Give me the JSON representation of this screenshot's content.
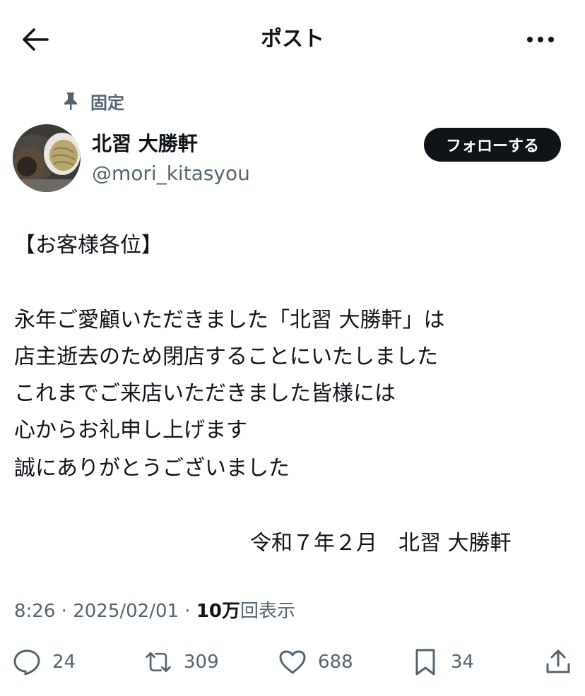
{
  "header": {
    "title": "ポスト",
    "back_icon": "arrow-left-icon",
    "more_icon": "more-horizontal-icon"
  },
  "pinned": {
    "label": "固定",
    "icon": "pin-icon"
  },
  "author": {
    "display_name": "北習 大勝軒",
    "handle": "@mori_kitasyou"
  },
  "follow_label": "フォローする",
  "post": {
    "lines": [
      "【お客様各位】",
      "永年ご愛顧いただきました「北習 大勝軒」は",
      "店主逝去のため閉店することにいたしました",
      "これまでご来店いただきました皆様には",
      "心からお礼申し上げます",
      "誠にありがとうございました"
    ],
    "signature": "令和７年２月　北習 大勝軒"
  },
  "meta": {
    "time": "8:26",
    "date": "2025/02/01",
    "views_count": "10万",
    "views_label": "回表示",
    "separator": " · "
  },
  "actions": {
    "replies": "24",
    "reposts": "309",
    "likes": "688",
    "bookmarks": "34"
  },
  "colors": {
    "text": "#0f1419",
    "secondary": "#536471",
    "button_bg": "#0f1419"
  }
}
